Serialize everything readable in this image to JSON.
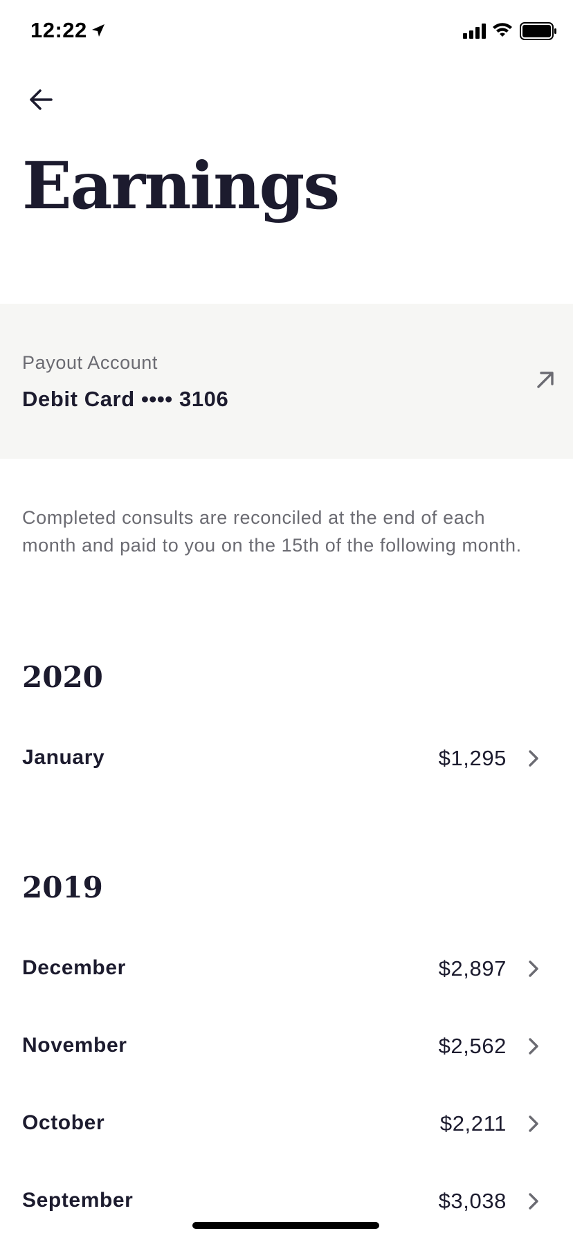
{
  "status_bar": {
    "time": "12:22"
  },
  "header": {
    "title": "Earnings"
  },
  "payout": {
    "label": "Payout Account",
    "value": "Debit Card •••• 3106"
  },
  "info": {
    "text": "Completed consults are reconciled at the end of each month and paid to you on the 15th of the following month."
  },
  "years": [
    {
      "year": "2020",
      "months": [
        {
          "name": "January",
          "amount": "$1,295"
        }
      ]
    },
    {
      "year": "2019",
      "months": [
        {
          "name": "December",
          "amount": "$2,897"
        },
        {
          "name": "November",
          "amount": "$2,562"
        },
        {
          "name": "October",
          "amount": "$2,211"
        },
        {
          "name": "September",
          "amount": "$3,038"
        }
      ]
    }
  ],
  "colors": {
    "text": "#1c1b2e",
    "muted": "#6b6b72",
    "card_bg": "#f6f6f4"
  }
}
